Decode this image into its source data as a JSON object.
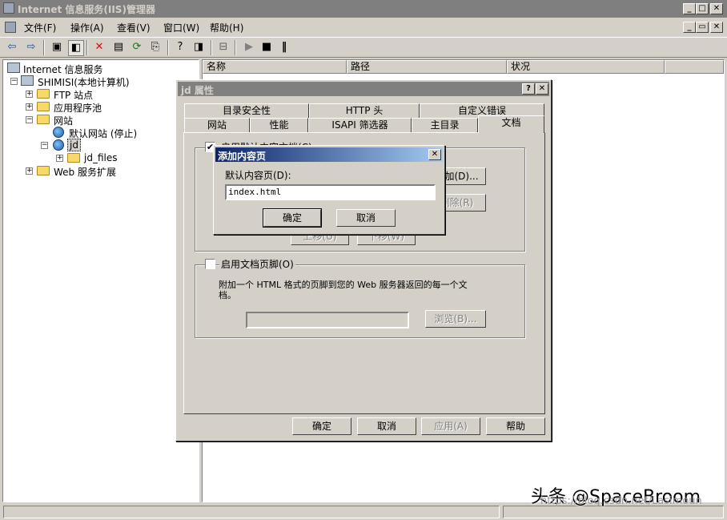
{
  "window": {
    "title": "Internet 信息服务(IIS)管理器"
  },
  "menu": [
    "文件(F)",
    "操作(A)",
    "查看(V)",
    "窗口(W)",
    "帮助(H)"
  ],
  "tree": {
    "root": "Internet 信息服务",
    "computer": "SHIMISI(本地计算机)",
    "ftp": "FTP 站点",
    "apppools": "应用程序池",
    "websites": "网站",
    "default_site": "默认网站 (停止)",
    "jd": "jd",
    "jd_files": "jd_files",
    "web_ext": "Web 服务扩展"
  },
  "list_columns": [
    "名称",
    "路径",
    "状况"
  ],
  "props_dialog": {
    "title": "jd 属性",
    "tabs_back": [
      "目录安全性",
      "HTTP 头",
      "自定义错误"
    ],
    "tabs_front": [
      "网站",
      "性能",
      "ISAPI 筛选器",
      "主目录",
      "文档"
    ],
    "enable_default": "启用默认内容文档(C)",
    "add_btn": "添加(D)...",
    "remove_btn": "删除(R)",
    "up_btn": "上移(U)",
    "down_btn": "下移(W)",
    "enable_footer": "启用文档页脚(O)",
    "footer_desc_1": "附加一个 HTML 格式的页脚到您的 Web 服务器返回的每一个文",
    "footer_desc_2": "档。",
    "browse_btn": "浏览(B)...",
    "ok": "确定",
    "cancel": "取消",
    "apply": "应用(A)",
    "help": "帮助"
  },
  "add_dialog": {
    "title": "添加内容页",
    "label": "默认内容页(D):",
    "value": "index.html",
    "ok": "确定",
    "cancel": "取消"
  },
  "watermark": {
    "main": "头条 @SpaceBroom",
    "sub": "https://blog.csdn.net/Lasimoun"
  }
}
